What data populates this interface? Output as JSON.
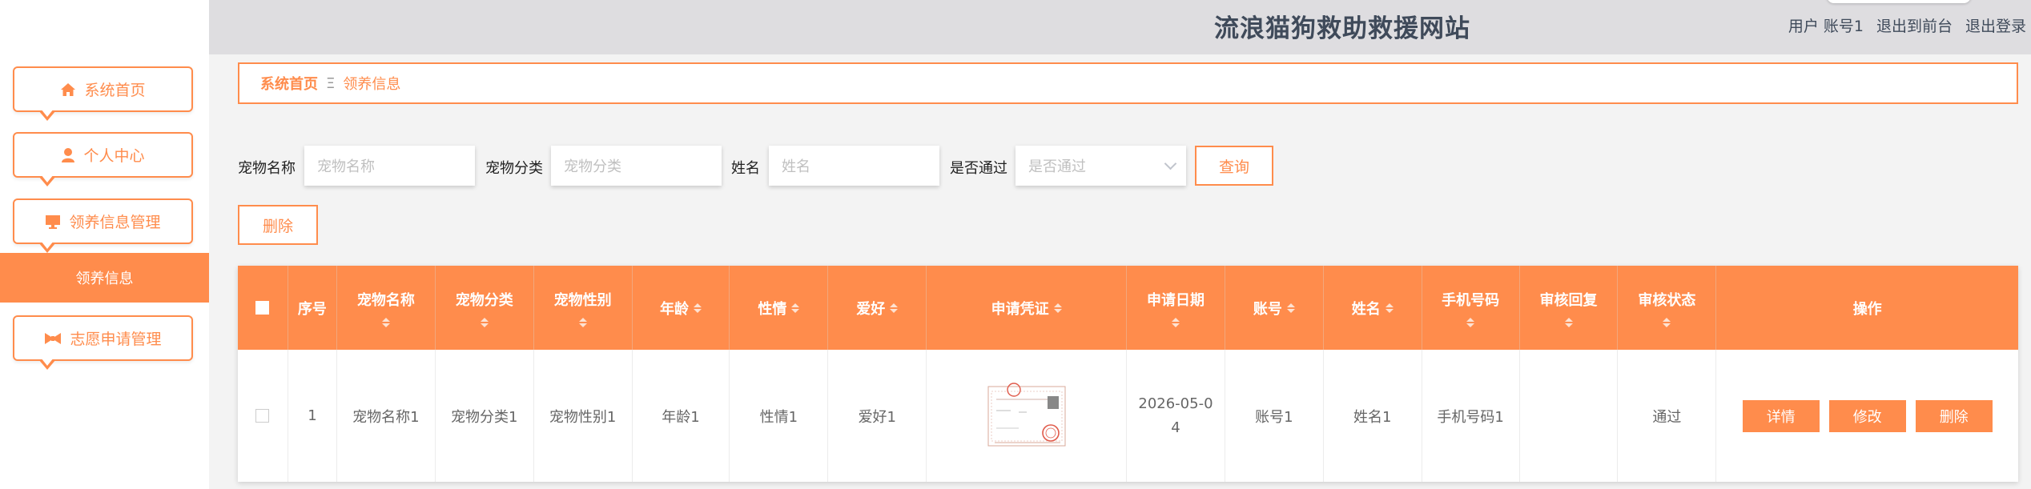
{
  "header": {
    "site_title": "流浪猫狗救助救援网站",
    "user_label": "用户 账号1",
    "back_to_front": "退出到前台",
    "logout": "退出登录"
  },
  "sidebar": {
    "items": [
      {
        "label": "系统首页",
        "icon": "home-icon"
      },
      {
        "label": "个人中心",
        "icon": "user-icon"
      },
      {
        "label": "领养信息管理",
        "icon": "monitor-icon"
      },
      {
        "label": "领养信息",
        "icon": ""
      },
      {
        "label": "志愿申请管理",
        "icon": "bowtie-icon"
      }
    ]
  },
  "breadcrumb": {
    "home": "系统首页",
    "separator": "Ξ",
    "current": "领养信息"
  },
  "search": {
    "pet_name_label": "宠物名称",
    "pet_name_placeholder": "宠物名称",
    "pet_type_label": "宠物分类",
    "pet_type_placeholder": "宠物分类",
    "name_label": "姓名",
    "name_placeholder": "姓名",
    "approved_label": "是否通过",
    "approved_placeholder": "是否通过",
    "query_button": "查询"
  },
  "toolbar": {
    "delete_button": "删除"
  },
  "table": {
    "columns": [
      "序号",
      "宠物名称",
      "宠物分类",
      "宠物性别",
      "年龄",
      "性情",
      "爱好",
      "申请凭证",
      "申请日期",
      "账号",
      "姓名",
      "手机号码",
      "审核回复",
      "审核状态",
      "操作"
    ],
    "rows": [
      {
        "index": "1",
        "pet_name": "宠物名称1",
        "pet_type": "宠物分类1",
        "pet_gender": "宠物性别1",
        "age": "年龄1",
        "temper": "性情1",
        "hobby": "爱好1",
        "apply_date": "2026-05-04",
        "account": "账号1",
        "name": "姓名1",
        "phone": "手机号码1",
        "reply": "",
        "status": "通过"
      }
    ],
    "actions": {
      "detail": "详情",
      "edit": "修改",
      "delete": "删除"
    }
  },
  "colors": {
    "accent": "#ff8c4c",
    "topbar": "#dedde0",
    "title": "#3f4a5a"
  }
}
